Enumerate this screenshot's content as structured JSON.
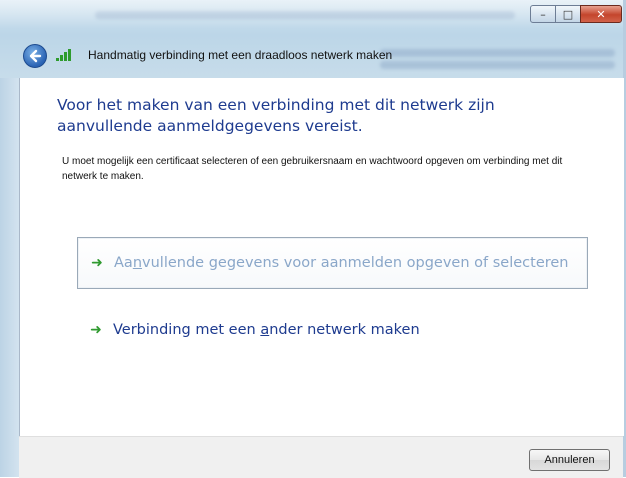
{
  "window": {
    "title": "Handmatig verbinding met een draadloos netwerk maken",
    "minimize_icon": "minimize-icon",
    "maximize_icon": "maximize-icon",
    "close_icon": "close-icon"
  },
  "nav": {
    "back_icon": "back-arrow-icon",
    "wifi_icon": "wireless-signal-icon"
  },
  "content": {
    "heading": "Voor het maken van een verbinding met dit netwerk zijn aanvullende aanmeldgegevens vereist.",
    "description": "U moet mogelijk een certificaat selecteren of een gebruikersnaam en wachtwoord opgeven om verbinding met dit netwerk te maken."
  },
  "options": [
    {
      "pre": "Aa",
      "accel": "n",
      "post": "vullende gegevens voor aanmelden opgeven of selecteren",
      "selected": true
    },
    {
      "pre": "Verbinding met een ",
      "accel": "a",
      "post": "nder netwerk maken",
      "selected": false
    }
  ],
  "footer": {
    "cancel_label": "Annuleren"
  },
  "colors": {
    "heading": "#1e3b8f",
    "arrow": "#2f9a2f",
    "glass": "#c4dae9"
  }
}
